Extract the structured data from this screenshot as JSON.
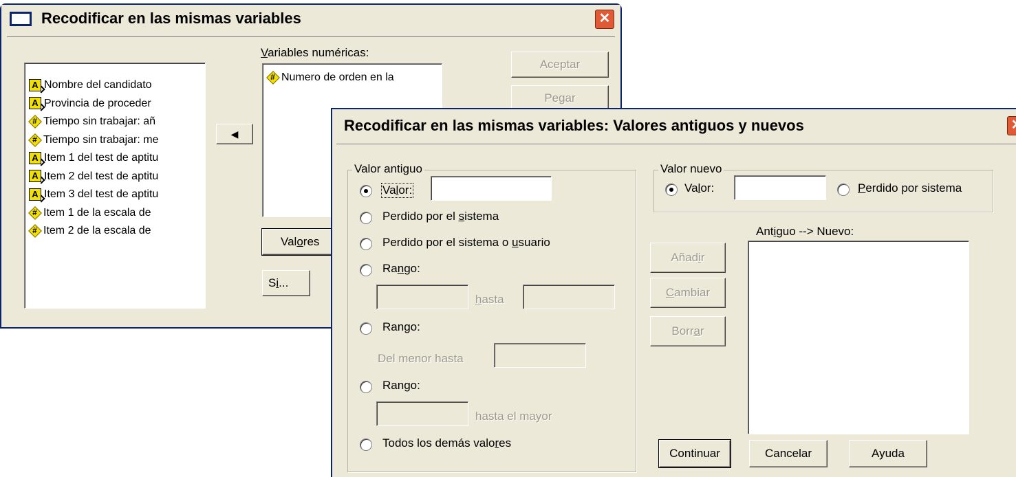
{
  "main_dialog": {
    "title": "Recodificar en las mismas variables",
    "close_glyph": "✕",
    "source_vars": [
      {
        "icon": "string",
        "label": "Nombre del candidato"
      },
      {
        "icon": "string",
        "label": "Provincia de proceder"
      },
      {
        "icon": "numeric",
        "label": "Tiempo sin trabajar: añ"
      },
      {
        "icon": "numeric",
        "label": "Tiempo sin trabajar: me"
      },
      {
        "icon": "ordinal",
        "label": "Item 1 del test de aptitu"
      },
      {
        "icon": "ordinal",
        "label": "Item 2 del test de aptitu"
      },
      {
        "icon": "ordinal",
        "label": "Item 3 del test de aptitu"
      },
      {
        "icon": "numeric",
        "label": "Item 1 de la escala de"
      },
      {
        "icon": "numeric",
        "label": "Item 2 de la escala de"
      }
    ],
    "move_arrow": "◀",
    "target_label": "Variables numéricas:",
    "target_vars": [
      {
        "icon": "numeric",
        "label": "Numero de orden en la"
      }
    ],
    "aceptar": "Aceptar",
    "pegar": "Pegar",
    "valores": "Valores",
    "si": "Si..."
  },
  "sub_dialog": {
    "title": "Recodificar en las mismas variables: Valores antiguos y nuevos",
    "close_glyph": "✕",
    "old_group": {
      "legend": "Valor antiguo",
      "valor": "Valor:",
      "valor_input": "",
      "perdido_sistema": "Perdido por el sistema",
      "perdido_usuario": "Perdido por el sistema o usuario",
      "rango1": "Rango:",
      "hasta": "hasta",
      "rango2": "Rango:",
      "del_menor": "Del menor hasta",
      "rango3": "Rango:",
      "hasta_mayor": "hasta el mayor",
      "todos": "Todos los demás valores"
    },
    "new_group": {
      "legend": "Valor nuevo",
      "valor": "Valor:",
      "valor_input": "",
      "perdido": "Perdido por sistema"
    },
    "antiguo_nuevo": "Antiguo --> Nuevo:",
    "anadir": "Añadir",
    "cambiar": "Cambiar",
    "borrar": "Borrar",
    "continuar": "Continuar",
    "cancelar": "Cancelar",
    "ayuda": "Ayuda"
  }
}
